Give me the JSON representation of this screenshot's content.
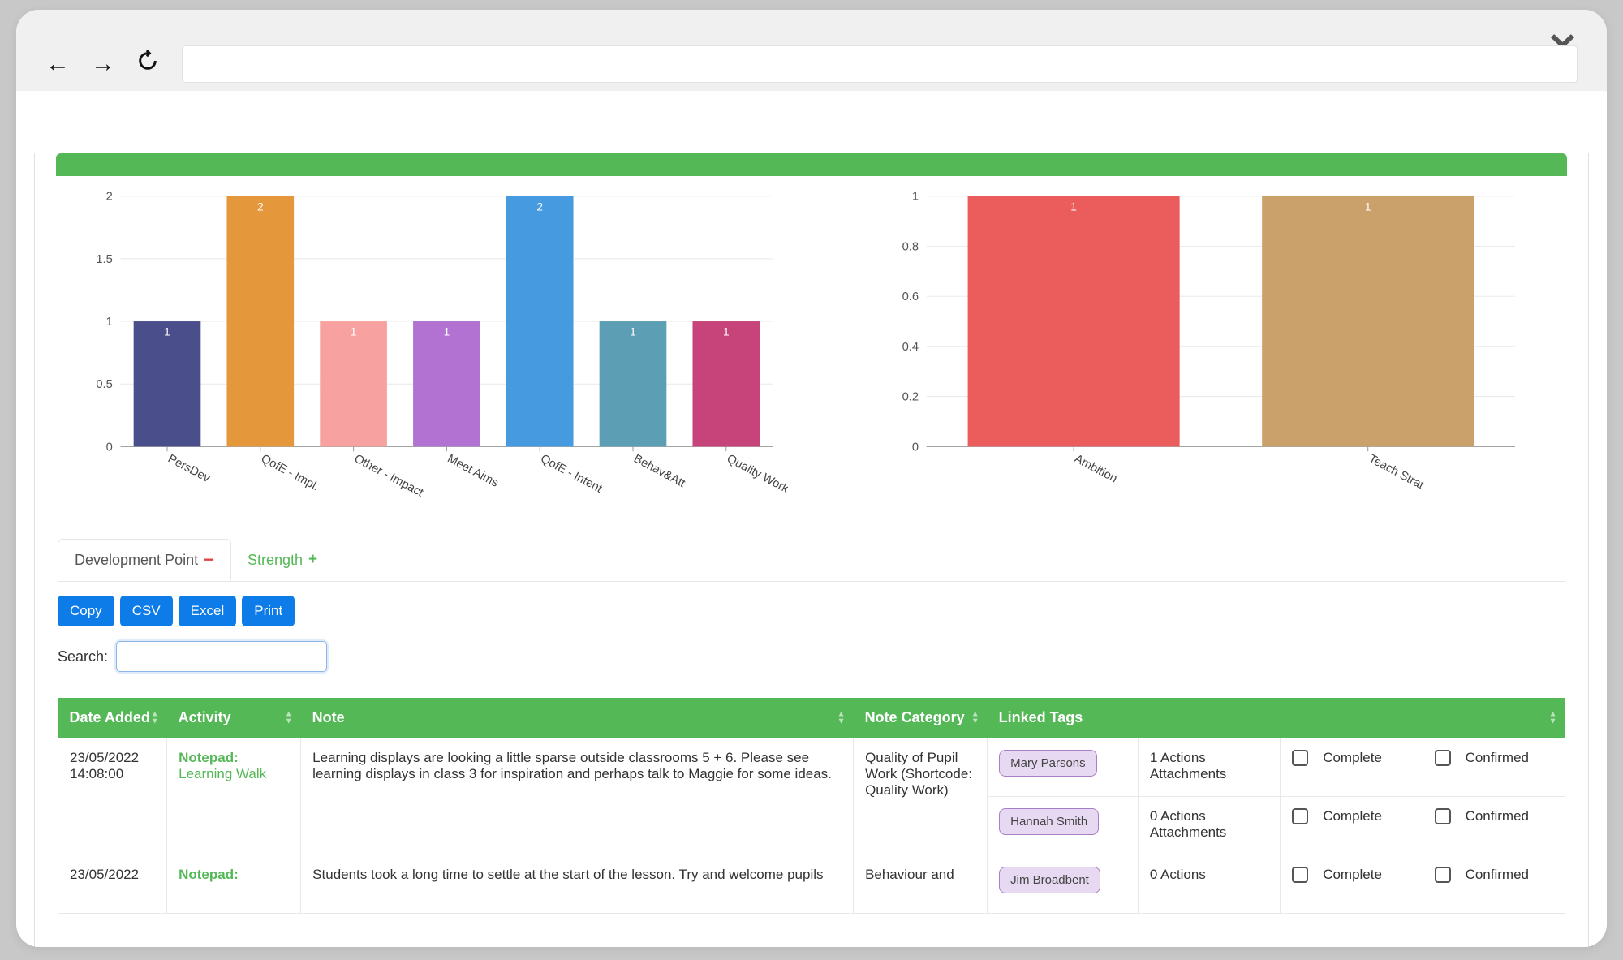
{
  "chart_data": [
    {
      "type": "bar",
      "categories": [
        "PersDev",
        "QofE - Impl.",
        "Other - Impact",
        "Meet Aims",
        "QofE - Intent",
        "Behav&Att",
        "Quality Work"
      ],
      "values": [
        1,
        2,
        1,
        1,
        2,
        1,
        1
      ],
      "colors": [
        "#4a4e8a",
        "#e5973b",
        "#f7a1a0",
        "#b272d1",
        "#459ae0",
        "#5c9eb3",
        "#c6447a"
      ],
      "ylim": [
        0,
        2
      ],
      "yticks": [
        0,
        0.5,
        1,
        1.5,
        2
      ]
    },
    {
      "type": "bar",
      "categories": [
        "Ambition",
        "Teach Strat"
      ],
      "values": [
        1,
        1
      ],
      "colors": [
        "#eb5c5c",
        "#caa06b"
      ],
      "ylim": [
        0,
        1
      ],
      "yticks": [
        0,
        0.2,
        0.4,
        0.6,
        0.8,
        1
      ]
    }
  ],
  "tabs": {
    "development": "Development Point",
    "strength": "Strength"
  },
  "exportButtons": {
    "copy": "Copy",
    "csv": "CSV",
    "excel": "Excel",
    "print": "Print"
  },
  "search": {
    "label": "Search:",
    "value": ""
  },
  "tableHeaders": {
    "date": "Date Added",
    "activity": "Activity",
    "note": "Note",
    "category": "Note Category",
    "tags": "Linked Tags"
  },
  "statusLabels": {
    "complete": "Complete",
    "confirmed": "Confirmed"
  },
  "rows": [
    {
      "date": "23/05/2022 14:08:00",
      "activityTitle": "Notepad:",
      "activitySub": "Learning Walk",
      "note": "Learning displays are looking a little sparse outside classrooms 5 + 6. Please see learning displays in class 3 for inspiration and perhaps talk to Maggie for some ideas.",
      "category": "Quality of Pupil Work (Shortcode: Quality Work)",
      "subrows": [
        {
          "tag": "Mary Parsons",
          "actions": "1 Actions",
          "attachments": "Attachments",
          "complete": "Complete",
          "confirmed": "Confirmed"
        },
        {
          "tag": "Hannah Smith",
          "actions": "0 Actions",
          "attachments": "Attachments",
          "complete": "Complete",
          "confirmed": "Confirmed"
        }
      ]
    },
    {
      "date": "23/05/2022",
      "activityTitle": "Notepad:",
      "activitySub": "",
      "note": "Students took a long time to settle at the start of the lesson. Try and welcome pupils",
      "category": "Behaviour and",
      "subrows": [
        {
          "tag": "Jim Broadbent",
          "actions": "0 Actions",
          "attachments": "",
          "complete": "Complete",
          "confirmed": "Confirmed"
        }
      ]
    }
  ]
}
